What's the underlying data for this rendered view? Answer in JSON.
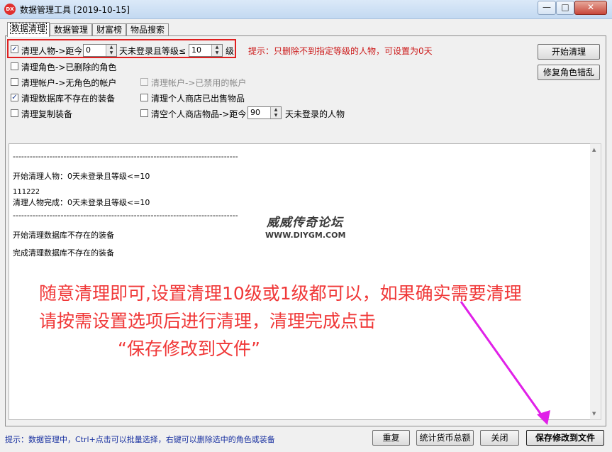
{
  "window": {
    "title": "数据管理工具 [2019-10-15]",
    "app_icon_text": "DX",
    "min_label": "—",
    "max_label": "□",
    "close_label": "✕"
  },
  "tabs": [
    {
      "label": "数据清理",
      "active": true
    },
    {
      "label": "数据管理"
    },
    {
      "label": "财富榜"
    },
    {
      "label": "物品搜索"
    }
  ],
  "options": {
    "clean_char": {
      "label": "清理人物->距今",
      "checked": true,
      "days": "0",
      "mid": "天未登录且等级≤",
      "level": "10",
      "suffix": "级"
    },
    "hint": "提示：只删除不到指定等级的人物，可设置为0天",
    "clean_role_deleted": {
      "label": "清理角色->已删除的角色",
      "checked": false
    },
    "clean_account_no_role": {
      "label": "清理帐户->无角色的帐户",
      "checked": false
    },
    "clean_account_disabled": {
      "label": "清理帐户->已禁用的帐户",
      "checked": false,
      "disabled": true
    },
    "clean_db_equip": {
      "label": "清理数据库不存在的装备",
      "checked": true
    },
    "clean_shop_sold": {
      "label": "清理个人商店已出售物品",
      "checked": false
    },
    "clean_copy_equip": {
      "label": "清理复制装备",
      "checked": false
    },
    "clear_shop_items": {
      "label": "清空个人商店物品->距今",
      "checked": false,
      "days": "90",
      "suffix": "天未登录的人物"
    }
  },
  "buttons": {
    "start_clean": "开始清理",
    "repair_role": "修复角色错乱",
    "reset": "重复",
    "stats_currency": "统计货币总额",
    "close": "关闭",
    "save_to_file": "保存修改到文件"
  },
  "log_lines": [
    "--------------------------------------------------------------------------------",
    "开始清理人物：0天未登录且等级<=10",
    "111222",
    "清理人物完成：0天未登录且等级<=10",
    "--------------------------------------------------------------------------------",
    "开始清理数据库不存在的装备",
    "完成清理数据库不存在的装备"
  ],
  "watermark": {
    "name": "威威传奇论坛",
    "url": "WWW.DIYGM.COM"
  },
  "annotation": {
    "line1": "随意清理即可,设置清理10级或1级都可以，如果确实需要清理",
    "line2": "请按需设置选项后进行清理，清理完成点击",
    "line3": "“保存修改到文件”"
  },
  "status_hint": "提示：数据管理中，Ctrl+点击可以批量选择，右键可以删除选中的角色或装备",
  "colors": {
    "annotation": "#f03838",
    "arrow": "#e020e8",
    "hint": "#cc1a1a",
    "highlight_box": "#e02020"
  }
}
